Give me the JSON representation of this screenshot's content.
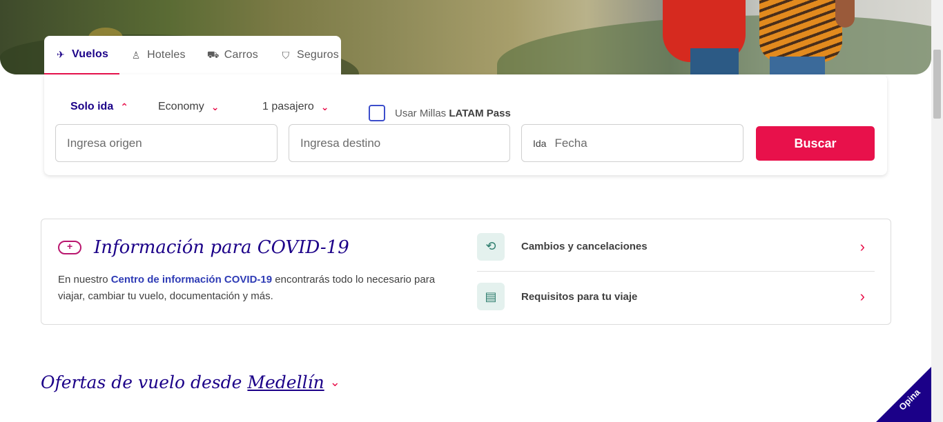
{
  "tabs": [
    {
      "label": "Vuelos",
      "icon": "plane-icon",
      "active": true
    },
    {
      "label": "Hoteles",
      "icon": "bellhop-icon",
      "active": false
    },
    {
      "label": "Carros",
      "icon": "car-icon",
      "active": false
    },
    {
      "label": "Seguros",
      "icon": "shield-icon",
      "active": false
    }
  ],
  "search": {
    "trip_type": "Solo ida",
    "cabin": "Economy",
    "passengers": "1 pasajero",
    "millas_prefix": "Usar Millas ",
    "millas_brand": "LATAM Pass",
    "origin_placeholder": "Ingresa origen",
    "destination_placeholder": "Ingresa destino",
    "date_prefix": "Ida",
    "date_placeholder": "Fecha",
    "search_button": "Buscar"
  },
  "covid": {
    "title": "Información para COVID-19",
    "text_before": "En nuestro ",
    "link": "Centro de información COVID-19",
    "text_after": " encontrarás todo lo necesario para viajar, cambiar tu vuelo, documentación y más.",
    "items": [
      {
        "label": "Cambios y cancelaciones",
        "icon": "exchange-icon"
      },
      {
        "label": "Requisitos para tu viaje",
        "icon": "document-id-icon"
      }
    ]
  },
  "offers": {
    "prefix": "Ofertas de vuelo desde",
    "city": "Medellín"
  },
  "feedback": {
    "label": "Opina"
  },
  "colors": {
    "brand": "#1b0088",
    "accent": "#e8114b"
  }
}
